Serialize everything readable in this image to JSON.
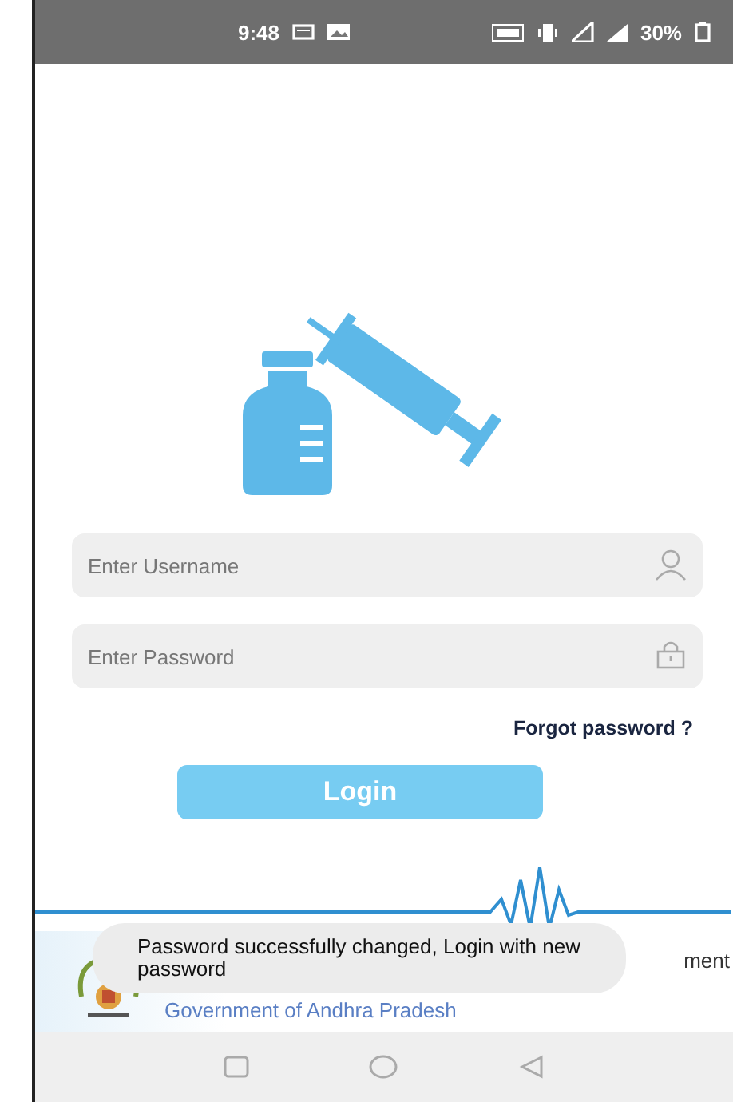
{
  "status_bar": {
    "time": "9:48",
    "battery": "30%"
  },
  "login_form": {
    "username": {
      "placeholder": "Enter Username"
    },
    "password": {
      "placeholder": "Enter Password"
    },
    "forgot_link": "Forgot password ?",
    "login_button": "Login"
  },
  "footer": {
    "department": "ment",
    "government": "Government of Andhra Pradesh"
  },
  "toast": {
    "message": "Password successfully changed, Login with new password"
  }
}
